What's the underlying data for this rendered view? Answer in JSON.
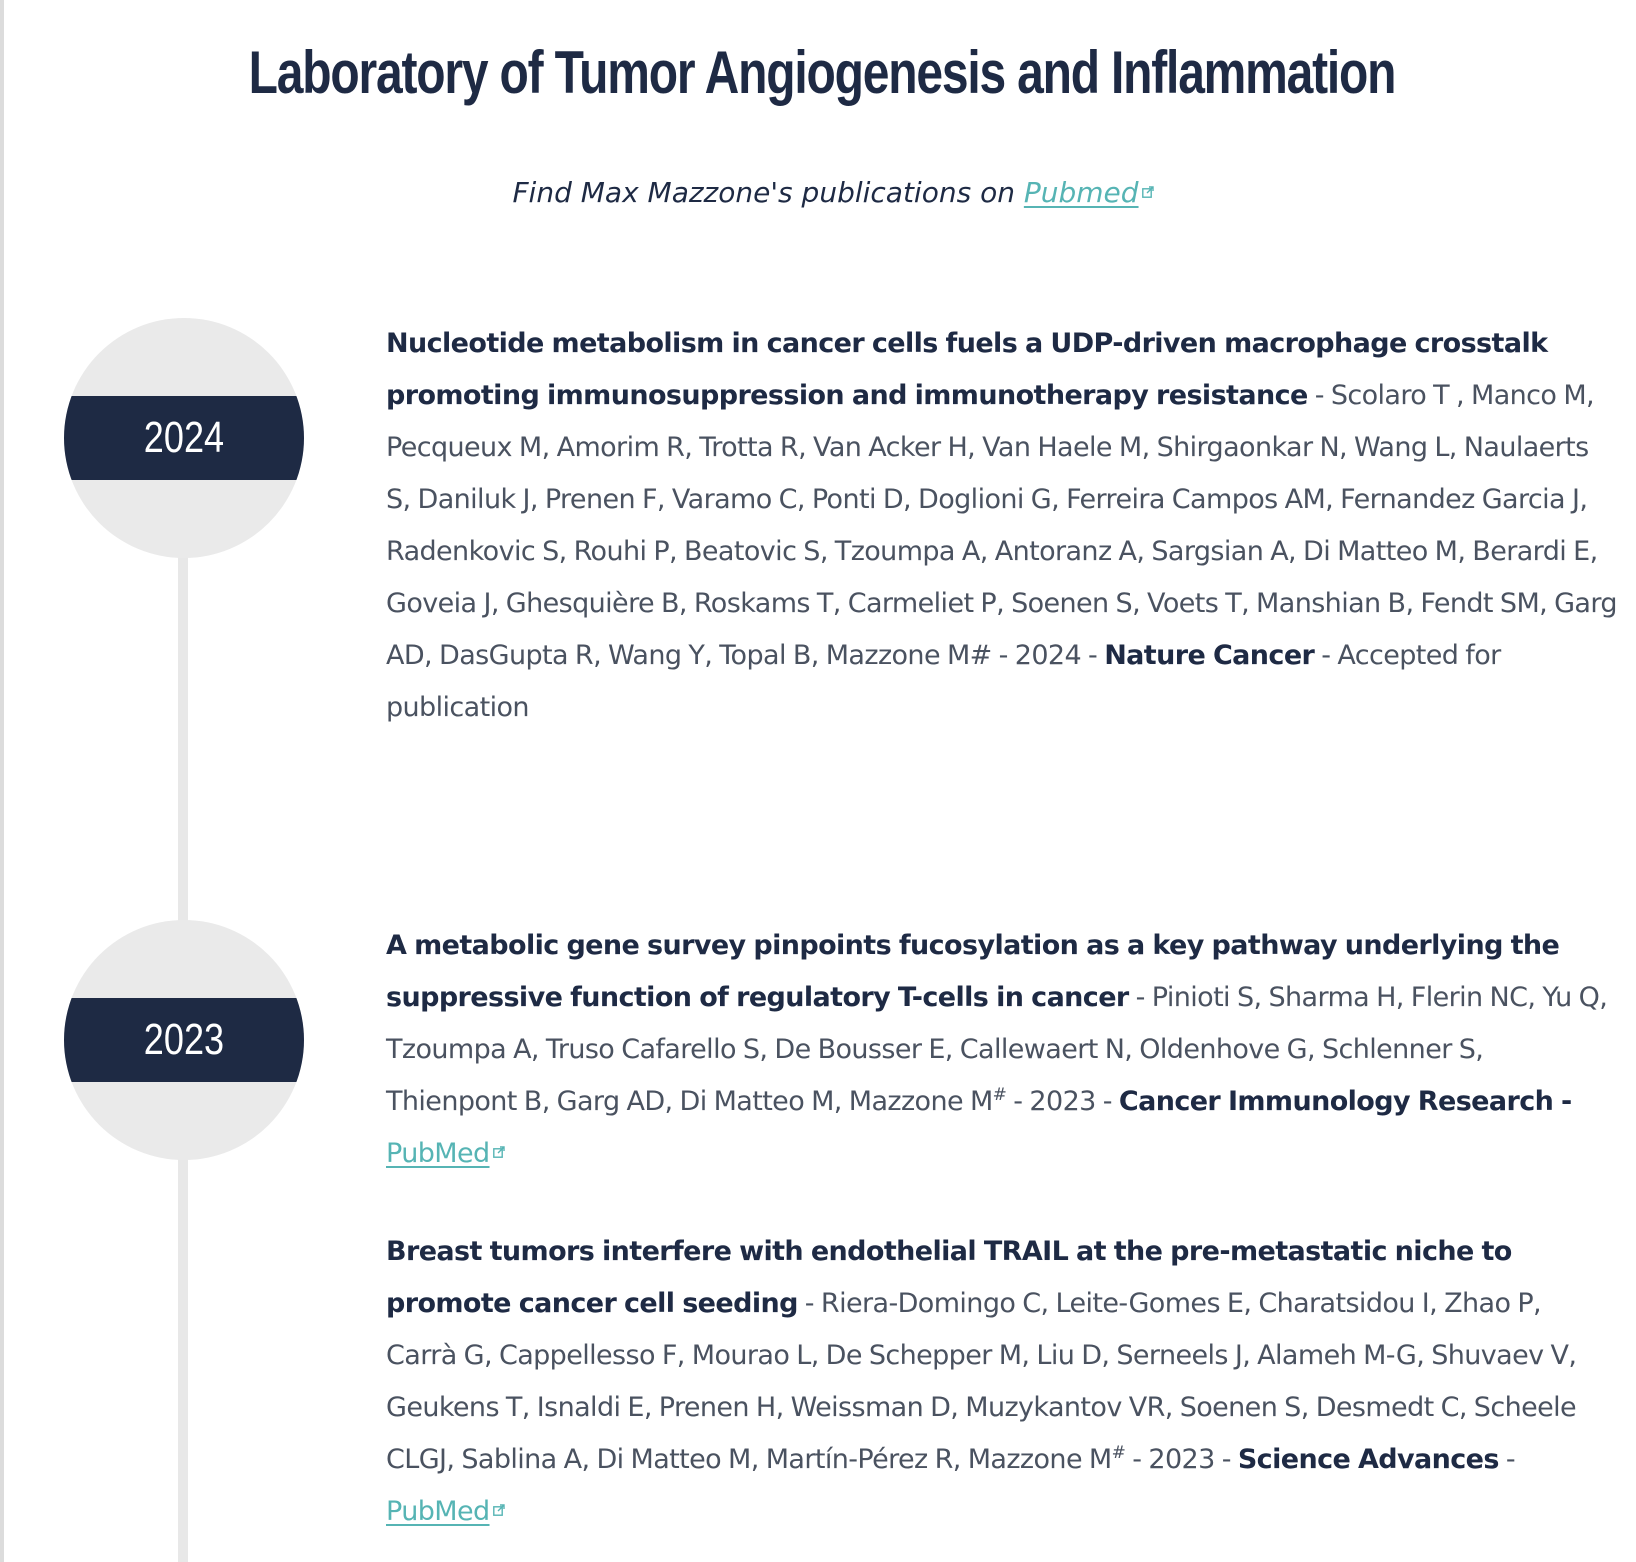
{
  "header": {
    "title": "Laboratory of Tumor Angiogenesis and Inflammation",
    "subtitle_prefix": "Find Max Mazzone's publications on ",
    "subtitle_link": "Pubmed"
  },
  "timeline": [
    {
      "year": "2024",
      "publications": [
        {
          "title": "Nucleotide metabolism in cancer cells fuels a UDP-driven macrophage crosstalk promoting immunosuppression and immunotherapy resistance",
          "authors": " - Scolaro T , Manco M, Pecqueux M, Amorim R, Trotta R, Van Acker H, Van Haele M, Shirgaonkar N, Wang L, Naulaerts S, Daniluk J, Prenen F, Varamo C, Ponti D, Doglioni G, Ferreira Campos AM, Fernandez Garcia J,  Radenkovic S, Rouhi P, Beatovic S, Tzoumpa A, Antoranz A, Sargsian A, Di Matteo M, Berardi E, Goveia J, Ghesquière B, Roskams T, Carmeliet P, Soenen S, Voets T, Manshian B, Fendt SM, Garg AD, DasGupta R, Wang Y, Topal B, Mazzone M# - 2024 - ",
          "journal": "Nature Cancer",
          "status": " - Accepted for publication"
        }
      ]
    },
    {
      "year": "2023",
      "publications": [
        {
          "title": "A metabolic gene survey pinpoints fucosylation as a key pathway underlying the suppressive function of regulatory T-cells in cancer",
          "authors": " - Pinioti S, Sharma H, Flerin NC, Yu Q, Tzoumpa A, Truso Cafarello S, De Bousser E, Callewaert N, Oldenhove G, Schlenner S, Thienpont B, Garg AD, Di Matteo M, Mazzone M",
          "sup": "#",
          "year_text": " - 2023 - ",
          "journal": "Cancer Immunology Research - ",
          "link": "PubMed"
        },
        {
          "title": "Breast tumors interfere with endothelial TRAIL at the pre-metastatic niche to promote cancer cell seeding",
          "authors": " - Riera-Domingo C, Leite-Gomes E, Charatsidou I, Zhao P, Carrà G, Cappellesso F, Mourao L, De Schepper M, Liu D, Serneels J, Alameh M-G, Shuvaev V, Geukens T, Isnaldi E, Prenen H, Weissman D, Muzykantov VR, Soenen S, Desmedt C, Scheele CLGJ, Sablina A, Di Matteo M, Martín-Pérez R, Mazzone M",
          "sup": "#",
          "year_text": "  - 2023 - ",
          "journal": "Science Advances",
          "sep": " - ",
          "link": "PubMed"
        }
      ]
    }
  ],
  "colors": {
    "navy": "#1e2a44",
    "teal_link": "#56b4b4",
    "circle_gray": "#eaeaea",
    "text_gray": "#4a5260"
  }
}
